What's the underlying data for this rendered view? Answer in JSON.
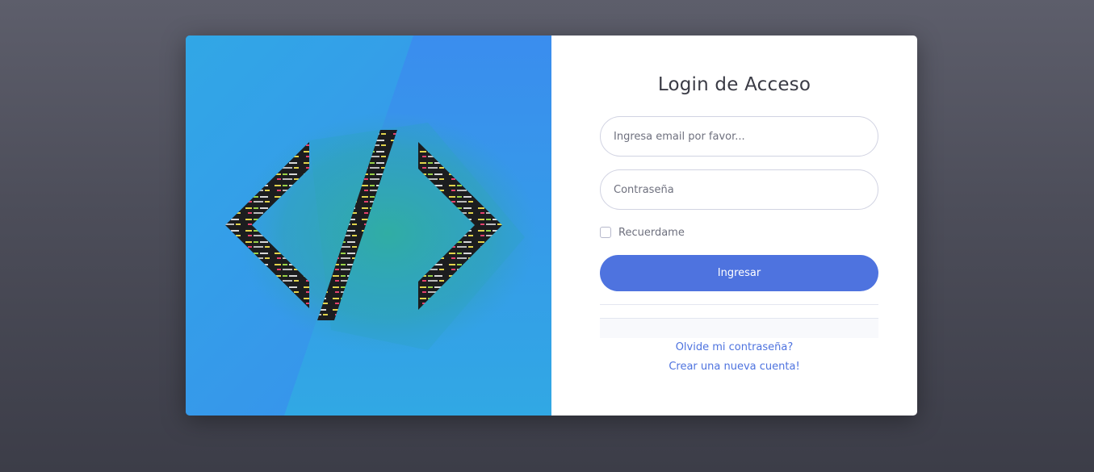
{
  "login": {
    "title": "Login de Acceso",
    "email_placeholder": "Ingresa email por favor...",
    "password_placeholder": "Contraseña",
    "remember_label": "Recuerdame",
    "remember_checked": false,
    "submit_label": "Ingresar",
    "forgot_link": "Olvide mi contraseña?",
    "register_link": "Crear una nueva cuenta!"
  },
  "illustration": {
    "icon": "code-brackets-icon"
  },
  "colors": {
    "page_background": "#4c4d59",
    "primary": "#4e73df",
    "illustration_blue": "#3592ec",
    "illustration_teal": "#33a0b4"
  }
}
